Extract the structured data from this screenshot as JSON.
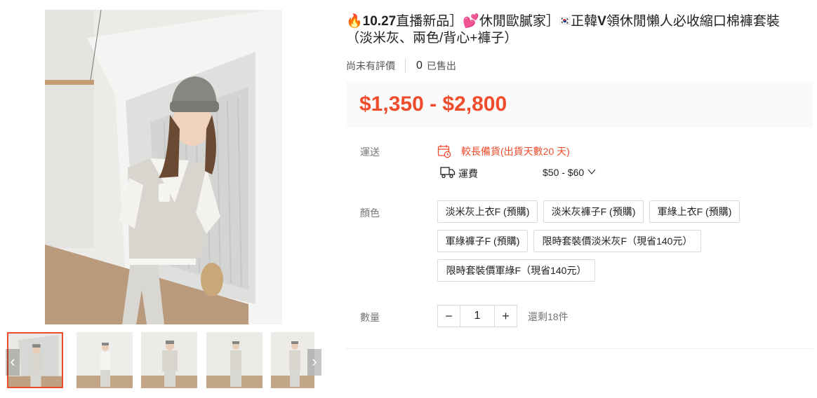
{
  "product": {
    "title_parts": {
      "flame": "🔥",
      "tag1": "10.27",
      "tag2": "直播新品］",
      "heart": "💕",
      "tag3": "休閒歐膩家］",
      "flag": "🇰🇷",
      "tag4": "正韓",
      "tag5": "V",
      "tag6": "領休閒懶人必收縮口棉褲套裝",
      "line2": "（淡米灰、兩色/背心+褲子）"
    },
    "rating_text": "尚未有評價",
    "sold_count": "0",
    "sold_label": "已售出",
    "price": "$1,350 - $2,800"
  },
  "shipping": {
    "label": "運送",
    "notice": "較長備貨(出貨天數20 天)",
    "fee_label": "運費",
    "fee_value": "$50 - $60"
  },
  "variation": {
    "label": "顏色",
    "options": [
      "淡米灰上衣F (預購)",
      "淡米灰褲子F (預購)",
      "軍綠上衣F (預購)",
      "軍綠褲子F (預購)",
      "限時套裝價淡米灰F（現省140元）",
      "限時套裝價軍綠F（現省140元）"
    ]
  },
  "quantity": {
    "label": "數量",
    "value": "1",
    "minus": "−",
    "plus": "+",
    "stock_text": "還剩18件"
  },
  "gallery": {
    "prev": "‹",
    "next": "›",
    "thumb_count": 5,
    "active_index": 0
  },
  "colors": {
    "accent": "#ee4d2d",
    "price_bg": "#fafafa",
    "border": "#d9d9d9"
  },
  "icons": [
    "calendar-clock-icon",
    "truck-icon",
    "chevron-down-icon",
    "chevron-left-icon",
    "chevron-right-icon"
  ]
}
